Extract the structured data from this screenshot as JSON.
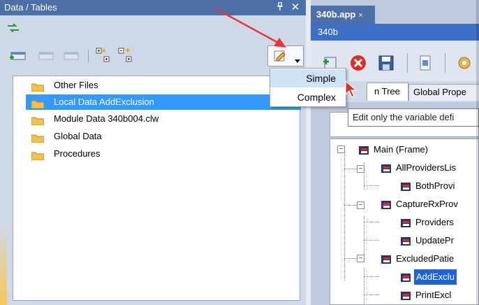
{
  "left_panel": {
    "title": "Data / Tables",
    "pin_glyph": " 1",
    "close_glyph": "✕",
    "tree": [
      {
        "label": "Other Files"
      },
      {
        "label": "Local Data AddExclusion",
        "selected": true
      },
      {
        "label": "Module Data 340b004.clw"
      },
      {
        "label": "Global Data"
      },
      {
        "label": "Procedures"
      }
    ],
    "menu": {
      "items": [
        "Simple",
        "Complex"
      ],
      "highlighted": "Simple"
    }
  },
  "right_panel": {
    "doc_tab": "340b.app",
    "doc_tab_close": "×",
    "header": "340b",
    "tabs": [
      "n Tree",
      "Global Prope"
    ],
    "tooltip": "Edit only the variable defi",
    "tree": [
      {
        "label": "Main (Frame)",
        "level": 0
      },
      {
        "label": "AllProvidersLis",
        "level": 1
      },
      {
        "label": "BothProvi",
        "level": 2
      },
      {
        "label": "CaptureRxProv",
        "level": 1
      },
      {
        "label": "Providers",
        "level": 2
      },
      {
        "label": "UpdatePr",
        "level": 2
      },
      {
        "label": "ExcludedPatie",
        "level": 1
      },
      {
        "label": "AddExclu",
        "level": 2,
        "selected": true
      },
      {
        "label": "PrintExcl",
        "level": 2
      }
    ]
  },
  "colors": {
    "title_bar": "#4d6fa8",
    "selection": "#3399ff",
    "tree_selection": "#1e63d6",
    "menu_highlight": "#cfe3f7",
    "arrow": "#e8383d"
  }
}
